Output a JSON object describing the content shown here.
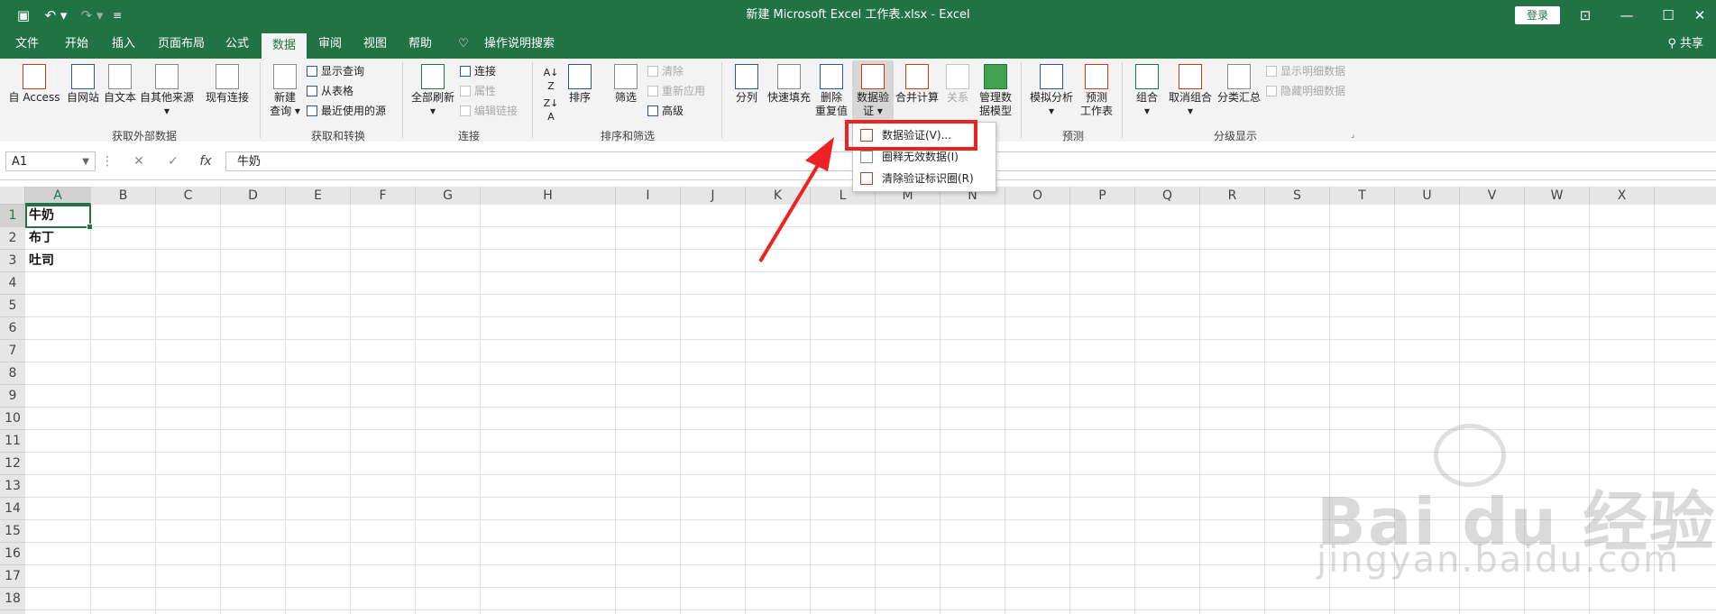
{
  "titlebar": {
    "title": "新建 Microsoft Excel 工作表.xlsx  -  Excel",
    "login_label": "登录"
  },
  "tabs": [
    "文件",
    "开始",
    "插入",
    "页面布局",
    "公式",
    "数据",
    "审阅",
    "视图",
    "帮助",
    "操作说明搜索"
  ],
  "active_tab": "数据",
  "share_label": "共享",
  "ribbon": {
    "get_external": {
      "access": "自 Access",
      "web": "自网站",
      "text": "自文本",
      "other1": "自其他来源",
      "other2": "▾",
      "existing": "现有连接",
      "group_label": "获取外部数据"
    },
    "get_transform": {
      "new_query1": "新建",
      "new_query2": "查询 ▾",
      "show_queries": "显示查询",
      "from_table": "从表格",
      "recent_sources": "最近使用的源",
      "group_label": "获取和转换"
    },
    "connections": {
      "refresh_all1": "全部刷新",
      "refresh_all2": "▾",
      "connections": "连接",
      "properties": "属性",
      "edit_links": "编辑链接",
      "group_label": "连接"
    },
    "sort_filter": {
      "sort": "排序",
      "filter": "筛选",
      "clear": "清除",
      "reapply": "重新应用",
      "advanced": "高级",
      "group_label": "排序和筛选"
    },
    "data_tools": {
      "text_to_columns": "分列",
      "flash_fill": "快速填充",
      "remove_dup1": "删除",
      "remove_dup2": "重复值",
      "validation1": "数据验",
      "validation2": "证 ▾",
      "consolidate": "合并计算",
      "relationships": "关系",
      "data_model1": "管理数",
      "data_model2": "据模型",
      "group_label": "数据工具"
    },
    "forecast": {
      "what_if1": "模拟分析",
      "what_if2": "▾",
      "sheet1": "预测",
      "sheet2": "工作表",
      "group_label": "预测"
    },
    "outline": {
      "group": "组合",
      "group2": "▾",
      "ungroup": "取消组合",
      "ungroup2": "▾",
      "subtotal": "分类汇总",
      "show_detail": "显示明细数据",
      "hide_detail": "隐藏明细数据",
      "group_label": "分级显示"
    }
  },
  "formula_bar": {
    "name_box": "A1",
    "cancel": "✕",
    "enter": "✓",
    "fx": "fx",
    "value": "牛奶"
  },
  "columns": [
    "A",
    "B",
    "C",
    "D",
    "E",
    "F",
    "G",
    "H",
    "I",
    "J",
    "K",
    "L",
    "M",
    "N",
    "O",
    "P",
    "Q",
    "R",
    "S",
    "T",
    "U",
    "V",
    "W",
    "X"
  ],
  "rows": [
    "1",
    "2",
    "3",
    "4",
    "5",
    "6",
    "7",
    "8",
    "9",
    "10",
    "11",
    "12",
    "13",
    "14",
    "15",
    "16",
    "17",
    "18"
  ],
  "cells": {
    "A1": "牛奶",
    "A2": "布丁",
    "A3": "吐司"
  },
  "dropdown": {
    "items": [
      "数据验证(V)...",
      "圈释无效数据(I)",
      "清除验证标识圈(R)"
    ]
  },
  "watermark": {
    "brand": "Bai du 经验",
    "url": "jingyan.baidu.com"
  },
  "colors": {
    "excel_green": "#217346",
    "highlight_red": "#ee2222"
  }
}
